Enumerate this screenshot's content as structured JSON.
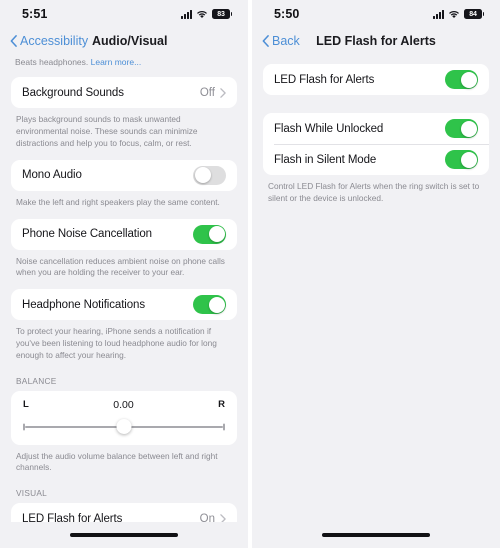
{
  "left_screen": {
    "status_bar": {
      "time": "5:51",
      "battery_percent": "83",
      "signal_icon": "cellular-signal-icon",
      "wifi_icon": "wifi-icon",
      "battery_icon": "battery-icon"
    },
    "nav": {
      "back_label": "Accessibility",
      "title": "Audio/Visual",
      "back_icon": "chevron-left-icon"
    },
    "top_note": {
      "text": "Beats headphones. ",
      "link_text": "Learn more..."
    },
    "rows": {
      "background_sounds": {
        "label": "Background Sounds",
        "value": "Off",
        "footnote": "Plays background sounds to mask unwanted environmental noise. These sounds can minimize distractions and help you to focus, calm, or rest."
      },
      "mono_audio": {
        "label": "Mono Audio",
        "state": "off",
        "footnote": "Make the left and right speakers play the same content."
      },
      "phone_noise_cancellation": {
        "label": "Phone Noise Cancellation",
        "state": "on",
        "footnote": "Noise cancellation reduces ambient noise on phone calls when you are holding the receiver to your ear."
      },
      "headphone_notifications": {
        "label": "Headphone Notifications",
        "state": "on",
        "footnote": "To protect your hearing, iPhone sends a notification if you've been listening to loud headphone audio for long enough to affect your hearing."
      }
    },
    "balance_section": {
      "header": "BALANCE",
      "left_label": "L",
      "right_label": "R",
      "value": "0.00",
      "footnote": "Adjust the audio volume balance between left and right channels."
    },
    "visual_section": {
      "header": "VISUAL",
      "led_flash": {
        "label": "LED Flash for Alerts",
        "value": "On"
      }
    }
  },
  "right_screen": {
    "status_bar": {
      "time": "5:50",
      "battery_percent": "84",
      "signal_icon": "cellular-signal-icon",
      "wifi_icon": "wifi-icon",
      "battery_icon": "battery-icon"
    },
    "nav": {
      "back_label": "Back",
      "title": "LED Flash for Alerts",
      "back_icon": "chevron-left-icon"
    },
    "rows": {
      "led_flash_for_alerts": {
        "label": "LED Flash for Alerts",
        "state": "on"
      },
      "flash_while_unlocked": {
        "label": "Flash While Unlocked",
        "state": "on"
      },
      "flash_in_silent_mode": {
        "label": "Flash in Silent Mode",
        "state": "on"
      }
    },
    "footnote": "Control LED Flash for Alerts when the ring switch is set to silent or the device is unlocked."
  },
  "colors": {
    "accent_blue": "#4d8fd6",
    "toggle_on_green": "#2fc34a",
    "toggle_off_grey": "#dededf",
    "background": "#f1f1f4",
    "card": "#ffffff"
  }
}
